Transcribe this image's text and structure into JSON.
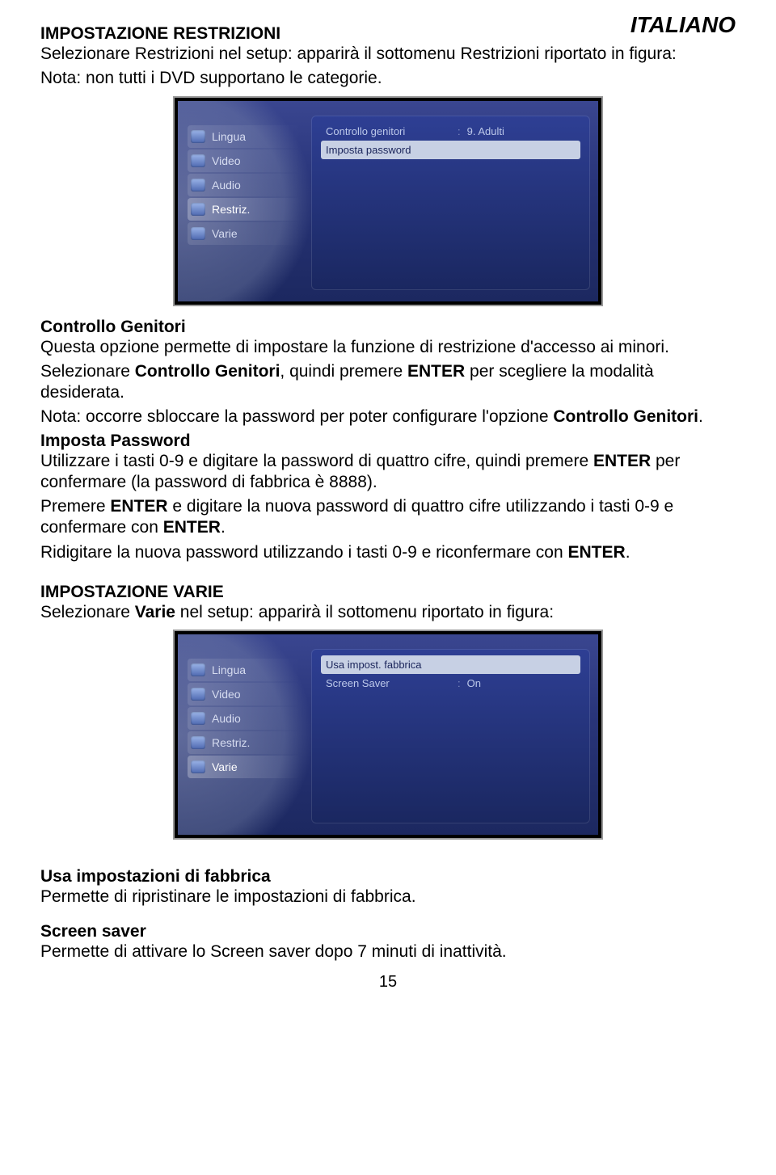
{
  "lang_tag": "ITALIANO",
  "sec1": {
    "title": "IMPOSTAZIONE RESTRIZIONI",
    "line1": "Selezionare Restrizioni nel setup: apparirà il sottomenu Restrizioni riportato in figura:",
    "line2": "Nota: non tutti i DVD supportano le categorie."
  },
  "shot1": {
    "sidebar": [
      {
        "label": "Lingua"
      },
      {
        "label": "Video"
      },
      {
        "label": "Audio"
      },
      {
        "label": "Restriz."
      },
      {
        "label": "Varie"
      }
    ],
    "selected_index": 3,
    "rows": [
      {
        "label": "Controllo genitori",
        "value": "9. Adulti",
        "hi": false
      },
      {
        "label": "Imposta password",
        "value": "",
        "hi": true
      }
    ]
  },
  "cg": {
    "title": "Controllo Genitori",
    "l1": "Questa opzione permette di impostare la funzione di restrizione d'accesso ai minori.",
    "l2a": "Selezionare ",
    "l2b": "Controllo Genitori",
    "l2c": ", quindi premere ",
    "l2d": "ENTER",
    "l2e": " per scegliere la modalità desiderata.",
    "l3a": "Nota: occorre sbloccare la password per poter configurare l'opzione ",
    "l3b": "Controllo Genitori",
    "l3c": "."
  },
  "ip": {
    "title": "Imposta Password",
    "l1a": "Utilizzare i tasti 0-9 e digitare la password di quattro cifre, quindi premere ",
    "l1b": "ENTER",
    "l1c": " per confermare (la password di fabbrica è 8888).",
    "l2a": "Premere ",
    "l2b": "ENTER",
    "l2c": " e digitare la nuova password di quattro cifre utilizzando i tasti 0-9 e confermare con ",
    "l2d": "ENTER",
    "l2e": ".",
    "l3a": "Ridigitare la nuova password utilizzando i tasti 0-9 e riconfermare con ",
    "l3b": "ENTER",
    "l3c": "."
  },
  "sec2": {
    "title": "IMPOSTAZIONE VARIE",
    "line1a": "Selezionare ",
    "line1b": "Varie",
    "line1c": " nel setup: apparirà il sottomenu riportato in figura:"
  },
  "shot2": {
    "sidebar": [
      {
        "label": "Lingua"
      },
      {
        "label": "Video"
      },
      {
        "label": "Audio"
      },
      {
        "label": "Restriz."
      },
      {
        "label": "Varie"
      }
    ],
    "selected_index": 4,
    "rows": [
      {
        "label": "Usa impost. fabbrica",
        "value": "",
        "hi": true
      },
      {
        "label": "Screen Saver",
        "value": "On",
        "hi": false
      }
    ]
  },
  "uf": {
    "title": "Usa impostazioni di fabbrica",
    "l1": "Permette di ripristinare le impostazioni di fabbrica."
  },
  "ss": {
    "title": "Screen saver",
    "l1": "Permette di attivare lo Screen saver dopo 7 minuti di inattività."
  },
  "page_number": "15"
}
